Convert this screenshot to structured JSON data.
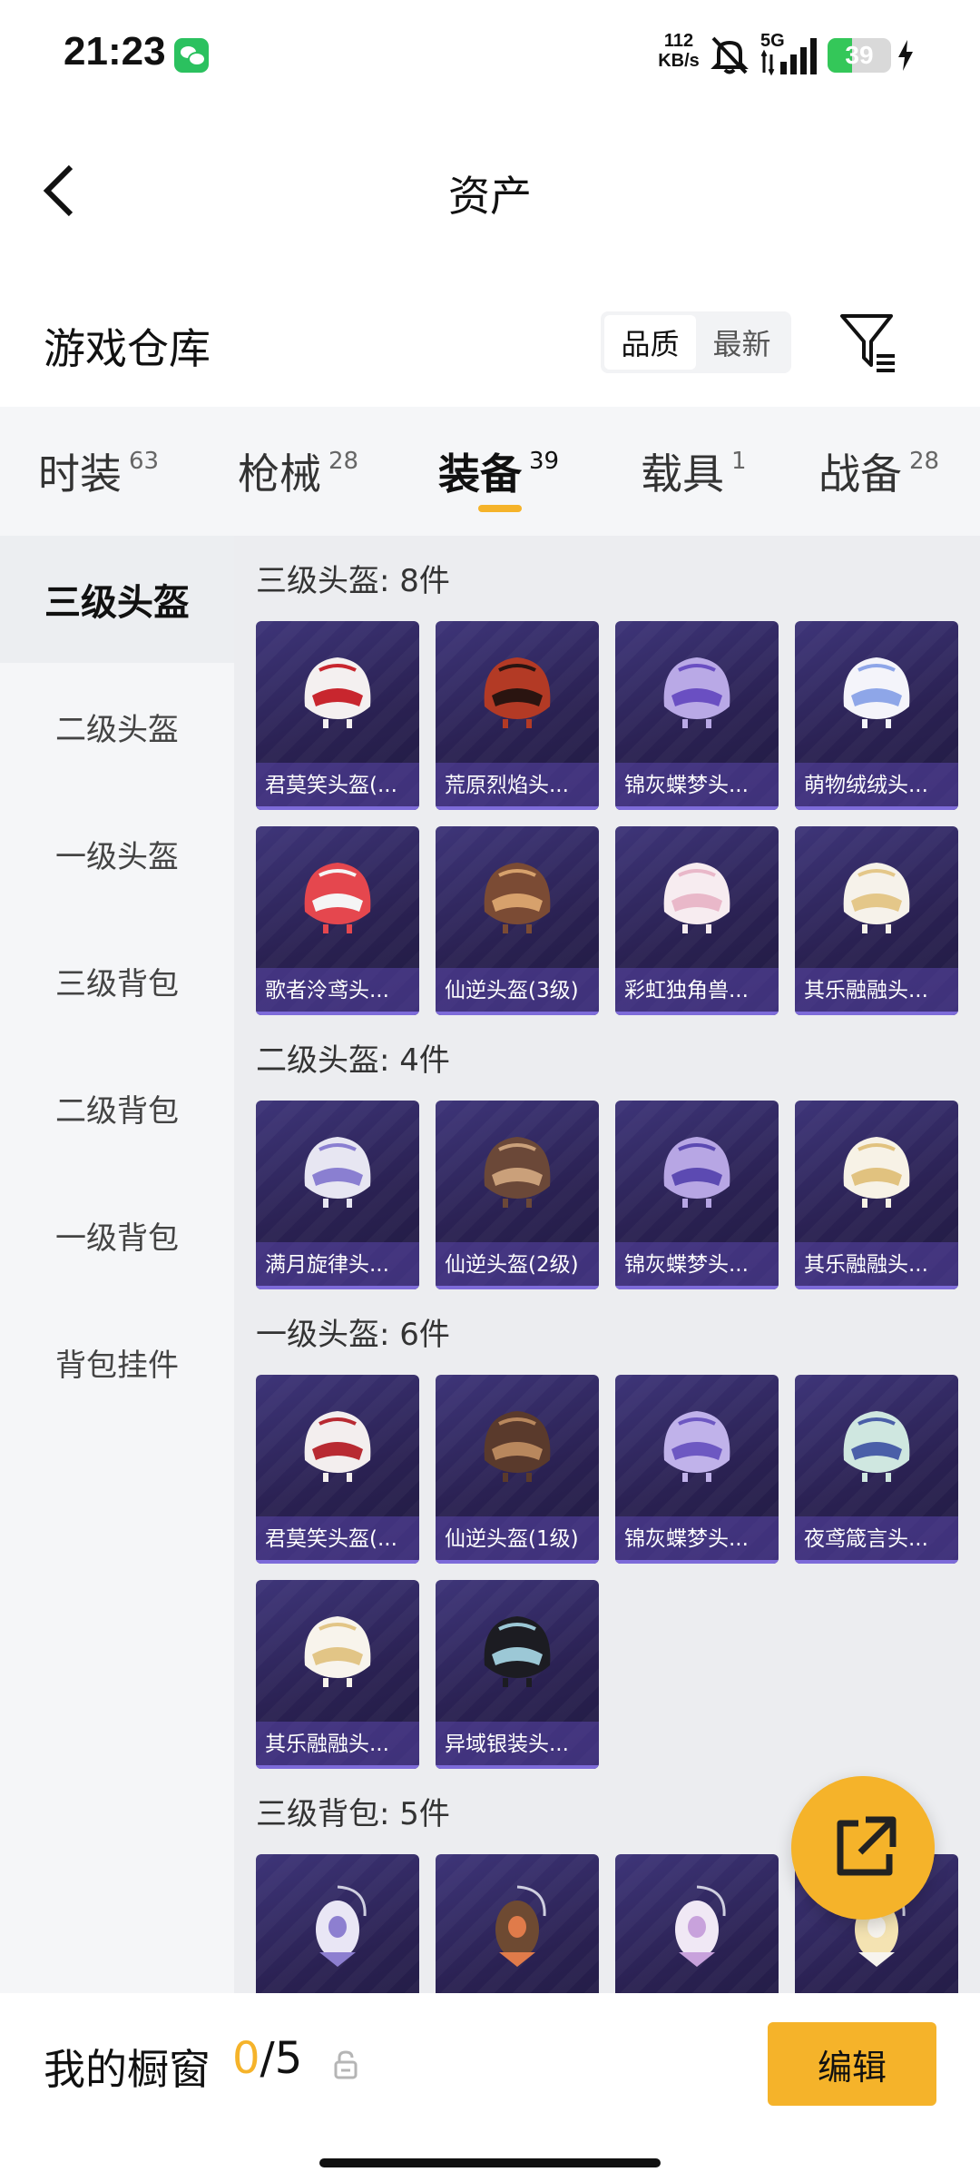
{
  "status_bar": {
    "time": "21:23",
    "net_speed_value": "112",
    "net_speed_unit": "KB/s",
    "network_type": "5G",
    "battery": "39",
    "battery_fraction": 0.39
  },
  "header": {
    "title": "资产"
  },
  "warehouse": {
    "title": "游戏仓库",
    "sort_options": [
      "品质",
      "最新"
    ],
    "active_sort": "品质"
  },
  "tabs": [
    {
      "label": "时装",
      "count": "63"
    },
    {
      "label": "枪械",
      "count": "28"
    },
    {
      "label": "装备",
      "count": "39"
    },
    {
      "label": "载具",
      "count": "1"
    },
    {
      "label": "战备",
      "count": "28"
    }
  ],
  "active_tab": "装备",
  "sidebar": {
    "items": [
      "三级头盔",
      "二级头盔",
      "一级头盔",
      "三级背包",
      "二级背包",
      "一级背包",
      "背包挂件"
    ],
    "active": "三级头盔"
  },
  "sections": [
    {
      "title": "三级头盔: 8件",
      "items": [
        {
          "label": "君莫笑头盔(...",
          "icon": "red-white-helmet",
          "colors": [
            "#f4f0f0",
            "#c8262e"
          ]
        },
        {
          "label": "荒原烈焰头...",
          "icon": "flame-helmet",
          "colors": [
            "#b33a25",
            "#2a1410"
          ]
        },
        {
          "label": "锦灰蝶梦头...",
          "icon": "butterfly-helmet",
          "colors": [
            "#b9a9e6",
            "#6a4fc2"
          ]
        },
        {
          "label": "萌物绒绒头...",
          "icon": "plush-helmet",
          "colors": [
            "#f4f4fa",
            "#8ea6e8"
          ]
        },
        {
          "label": "歌者泠鸢头...",
          "icon": "singer-helmet",
          "colors": [
            "#e5474e",
            "#f5f5f5"
          ]
        },
        {
          "label": "仙逆头盔(3级)",
          "icon": "dragon-helmet",
          "colors": [
            "#7b4b34",
            "#d7a16c"
          ]
        },
        {
          "label": "彩虹独角兽...",
          "icon": "unicorn-helmet",
          "colors": [
            "#f7ecf0",
            "#e9b8c9"
          ]
        },
        {
          "label": "其乐融融头...",
          "icon": "cream-helmet",
          "colors": [
            "#f6f2ea",
            "#e4c789"
          ]
        }
      ]
    },
    {
      "title": "二级头盔: 4件",
      "items": [
        {
          "label": "满月旋律头...",
          "icon": "moon-helmet",
          "colors": [
            "#e7e6f2",
            "#8a7fd1"
          ]
        },
        {
          "label": "仙逆头盔(2级)",
          "icon": "dragon-helmet",
          "colors": [
            "#6b4838",
            "#caa07a"
          ]
        },
        {
          "label": "锦灰蝶梦头...",
          "icon": "butterfly-helmet",
          "colors": [
            "#b7a6e4",
            "#5c4ab2"
          ]
        },
        {
          "label": "其乐融融头...",
          "icon": "cream-helmet",
          "colors": [
            "#f7f2e6",
            "#e1c27f"
          ]
        }
      ]
    },
    {
      "title": "一级头盔: 6件",
      "items": [
        {
          "label": "君莫笑头盔(...",
          "icon": "red-white-helmet",
          "colors": [
            "#f3eeee",
            "#b82a32"
          ]
        },
        {
          "label": "仙逆头盔(1级)",
          "icon": "dragon-helmet",
          "colors": [
            "#5a3a2c",
            "#b8875d"
          ]
        },
        {
          "label": "锦灰蝶梦头...",
          "icon": "butterfly-helmet",
          "colors": [
            "#c0b2ea",
            "#6d58c2"
          ]
        },
        {
          "label": "夜鸢箴言头...",
          "icon": "kite-helmet",
          "colors": [
            "#cfe7e0",
            "#4a5fa8"
          ]
        },
        {
          "label": "其乐融融头...",
          "icon": "cream-helmet",
          "colors": [
            "#f8f4ec",
            "#e2c586"
          ]
        },
        {
          "label": "异域银装头...",
          "icon": "silver-helmet",
          "colors": [
            "#1c1c22",
            "#9cc8d6"
          ]
        }
      ]
    },
    {
      "title": "三级背包: 5件",
      "items": [
        {
          "label": "",
          "icon": "lantern-backpack",
          "colors": [
            "#e9e6f5",
            "#8d7fd0"
          ]
        },
        {
          "label": "",
          "icon": "dragon-backpack",
          "colors": [
            "#6e4a32",
            "#e07b4a"
          ]
        },
        {
          "label": "",
          "icon": "bow-backpack",
          "colors": [
            "#f0e8f5",
            "#c8a2dc"
          ]
        },
        {
          "label": "",
          "icon": "plush-backpack",
          "colors": [
            "#f4e3b2",
            "#f7f4ee"
          ]
        }
      ]
    }
  ],
  "bottom_bar": {
    "showcase_label": "我的橱窗",
    "showcase_used": "0",
    "showcase_total": "/5",
    "edit_label": "编辑"
  },
  "accent_color": "#f5b32a"
}
